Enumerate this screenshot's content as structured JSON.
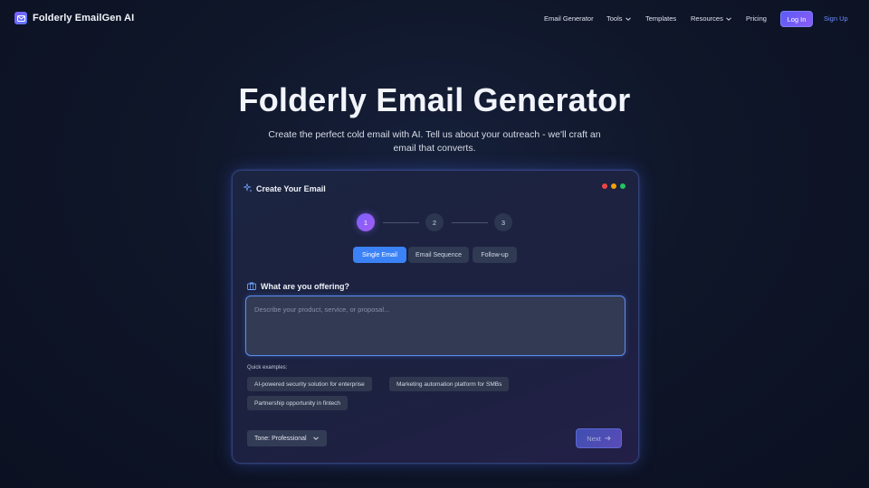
{
  "brand": {
    "name": "Folderly EmailGen AI",
    "accent": "#7c5cff"
  },
  "nav": {
    "links": [
      {
        "label": "Email Generator"
      },
      {
        "label": "Tools"
      },
      {
        "label": "Templates"
      },
      {
        "label": "Resources"
      },
      {
        "label": "Pricing"
      }
    ],
    "login": "Log In",
    "signup": "Sign Up"
  },
  "hero": {
    "title": "Folderly Email Generator",
    "subtitle_line1": "Create the perfect cold email with AI. Tell us about your outreach - we'll craft an",
    "subtitle_line2": "email that converts."
  },
  "card": {
    "title": "Create Your Email",
    "window_dots": [
      "#ef4444",
      "#f59e0b",
      "#22c55e"
    ],
    "steps": [
      "1",
      "2",
      "3"
    ],
    "active_step": 1,
    "tabs": [
      "Single Email",
      "Email Sequence",
      "Follow-up"
    ],
    "active_tab": "Single Email",
    "question": "What are you offering?",
    "input_placeholder": "Describe your product, service, or proposal...",
    "quick_examples_label": "Quick examples:",
    "examples": [
      "AI-powered security solution for enterprise",
      "Marketing automation platform for SMBs",
      "Partnership opportunity in fintech"
    ],
    "tone_label": "Tone: Professional",
    "next_label": "Next"
  },
  "icons": [
    "mail-icon",
    "chevron-down-icon",
    "sparkle-icon",
    "briefcase-icon",
    "arrow-right-icon"
  ]
}
